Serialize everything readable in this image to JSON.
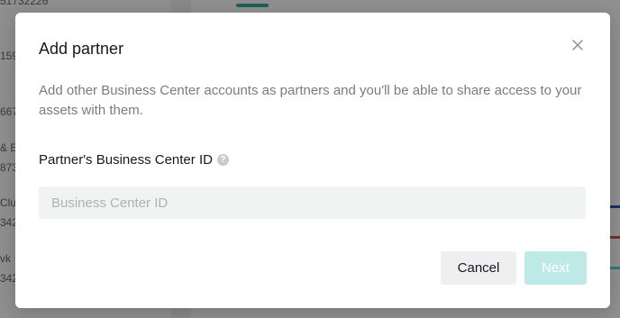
{
  "background": {
    "rows": [
      {
        "text": "51732226"
      },
      {
        "text": "159"
      },
      {
        "text": "667"
      },
      {
        "text": "& E"
      },
      {
        "text": "873"
      },
      {
        "text": "Clu"
      },
      {
        "text": "342"
      },
      {
        "text": "vk"
      },
      {
        "text": "342"
      }
    ]
  },
  "modal": {
    "title": "Add partner",
    "close_icon": "close-icon",
    "description": "Add other Business Center accounts as partners and you'll be able to share access to your assets with them.",
    "field_label": "Partner's Business Center ID",
    "help_icon_glyph": "?",
    "input": {
      "value": "",
      "placeholder": "Business Center ID"
    },
    "cancel_label": "Cancel",
    "next_label": "Next"
  },
  "colors": {
    "accent_disabled": "#bfe9e7",
    "tab_underline": "#1f5e5c"
  }
}
